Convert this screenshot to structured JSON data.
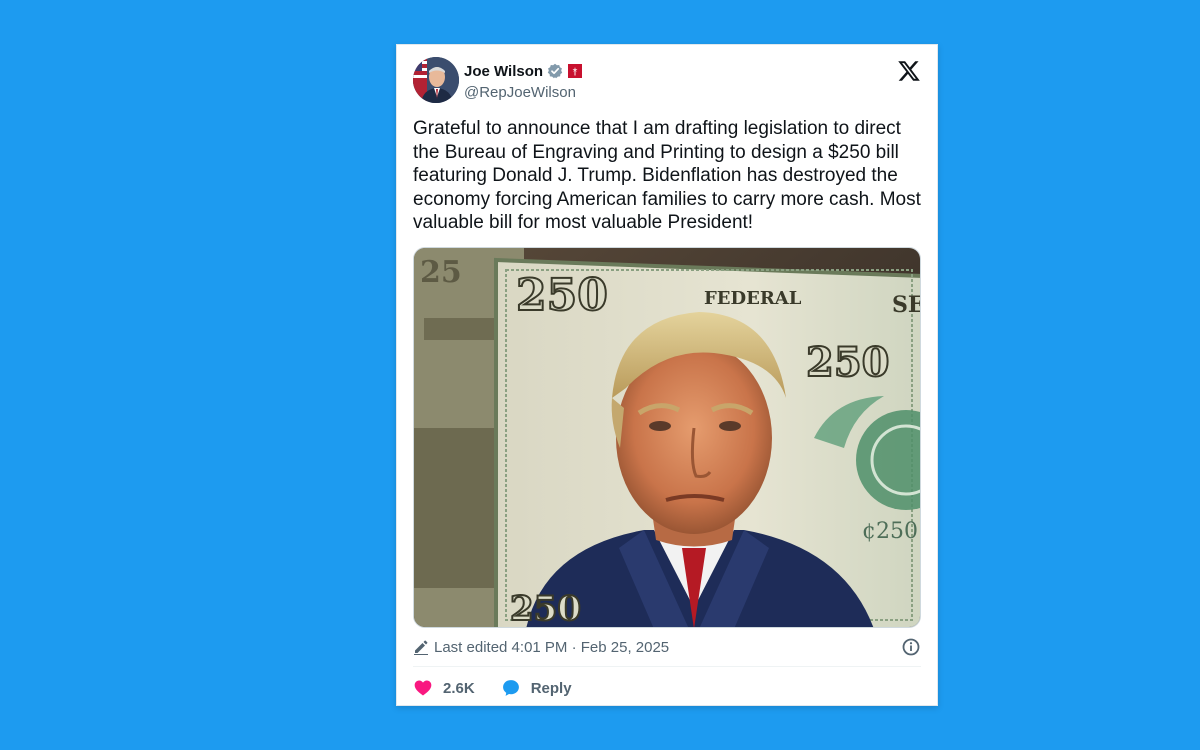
{
  "tweet": {
    "author_name": "Joe Wilson",
    "author_handle": "@RepJoeWilson",
    "text": "Grateful to announce that I am drafting legislation to direct the Bureau of Engraving and Printing to design a $250 bill featuring Donald J. Trump. Bidenflation has destroyed the economy forcing American families to carry more cash. Most valuable bill for most valuable President!",
    "edited_label": "Last edited 4:01 PM · Feb 25, 2025",
    "likes": "2.6K",
    "reply_label": "Reply"
  },
  "media": {
    "bill_denomination": "250",
    "bill_text_top": "FEDERAL",
    "bill_text_right": "SE",
    "bill_small_value": "¢250"
  },
  "icons": {
    "verified": "verified-badge-icon",
    "flag": "south-carolina-flag-icon",
    "logo": "x-logo-icon",
    "pencil": "pencil-icon",
    "info": "info-icon",
    "heart": "heart-icon",
    "reply": "reply-bubble-icon"
  },
  "colors": {
    "background": "#1d9bf0",
    "like": "#f91880",
    "reply": "#1d9bf0",
    "verified": "#829aab",
    "flag": "#c8102e"
  }
}
